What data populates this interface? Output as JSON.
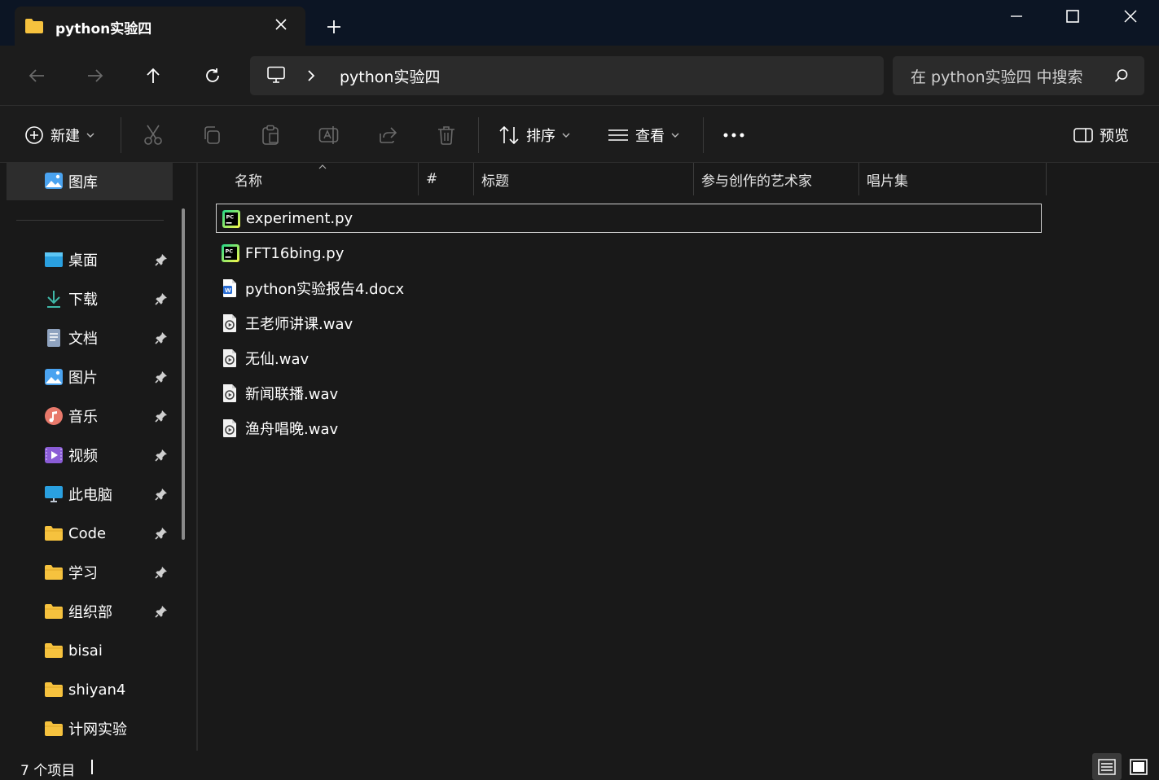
{
  "window": {
    "tab_title": "python实验四",
    "new_tab_symbol": "+"
  },
  "address": {
    "location_icon": "computer-icon",
    "path": "python实验四"
  },
  "search": {
    "placeholder": "在 python实验四 中搜索"
  },
  "toolbar": {
    "new_label": "新建",
    "sort_label": "排序",
    "view_label": "查看",
    "preview_label": "预览",
    "more_symbol": "•••",
    "icons": [
      "cut-icon",
      "copy-icon",
      "paste-icon",
      "rename-icon",
      "share-icon",
      "delete-icon"
    ]
  },
  "sidebar": {
    "gallery_label": "图库",
    "items": [
      {
        "label": "桌面",
        "icon": "desktop-icon",
        "pinned": true
      },
      {
        "label": "下载",
        "icon": "download-icon",
        "pinned": true
      },
      {
        "label": "文档",
        "icon": "document-icon",
        "pinned": true
      },
      {
        "label": "图片",
        "icon": "pictures-icon",
        "pinned": true
      },
      {
        "label": "音乐",
        "icon": "music-icon",
        "pinned": true
      },
      {
        "label": "视频",
        "icon": "video-icon",
        "pinned": true
      },
      {
        "label": "此电脑",
        "icon": "this-pc-icon",
        "pinned": true
      },
      {
        "label": "Code",
        "icon": "folder-icon",
        "pinned": true
      },
      {
        "label": "学习",
        "icon": "folder-icon",
        "pinned": true
      },
      {
        "label": "组织部",
        "icon": "folder-icon",
        "pinned": true
      },
      {
        "label": "bisai",
        "icon": "folder-icon",
        "pinned": false
      },
      {
        "label": "shiyan4",
        "icon": "folder-icon",
        "pinned": false
      },
      {
        "label": "计网实验",
        "icon": "folder-icon",
        "pinned": false
      }
    ]
  },
  "columns": [
    "名称",
    "#",
    "标题",
    "参与创作的艺术家",
    "唱片集"
  ],
  "files": [
    {
      "name": "experiment.py",
      "type": "pycharm",
      "selected": true
    },
    {
      "name": "FFT16bing.py",
      "type": "pycharm",
      "selected": false
    },
    {
      "name": "python实验报告4.docx",
      "type": "word",
      "selected": false
    },
    {
      "name": "王老师讲课.wav",
      "type": "audio",
      "selected": false
    },
    {
      "name": "无仙.wav",
      "type": "audio",
      "selected": false
    },
    {
      "name": "新闻联播.wav",
      "type": "audio",
      "selected": false
    },
    {
      "name": "渔舟唱晚.wav",
      "type": "audio",
      "selected": false
    }
  ],
  "status": {
    "item_count": "7 个项目"
  },
  "colors": {
    "accent_folder": "#f6c23e",
    "background": "#191919",
    "titlebar": "#0c1524"
  }
}
